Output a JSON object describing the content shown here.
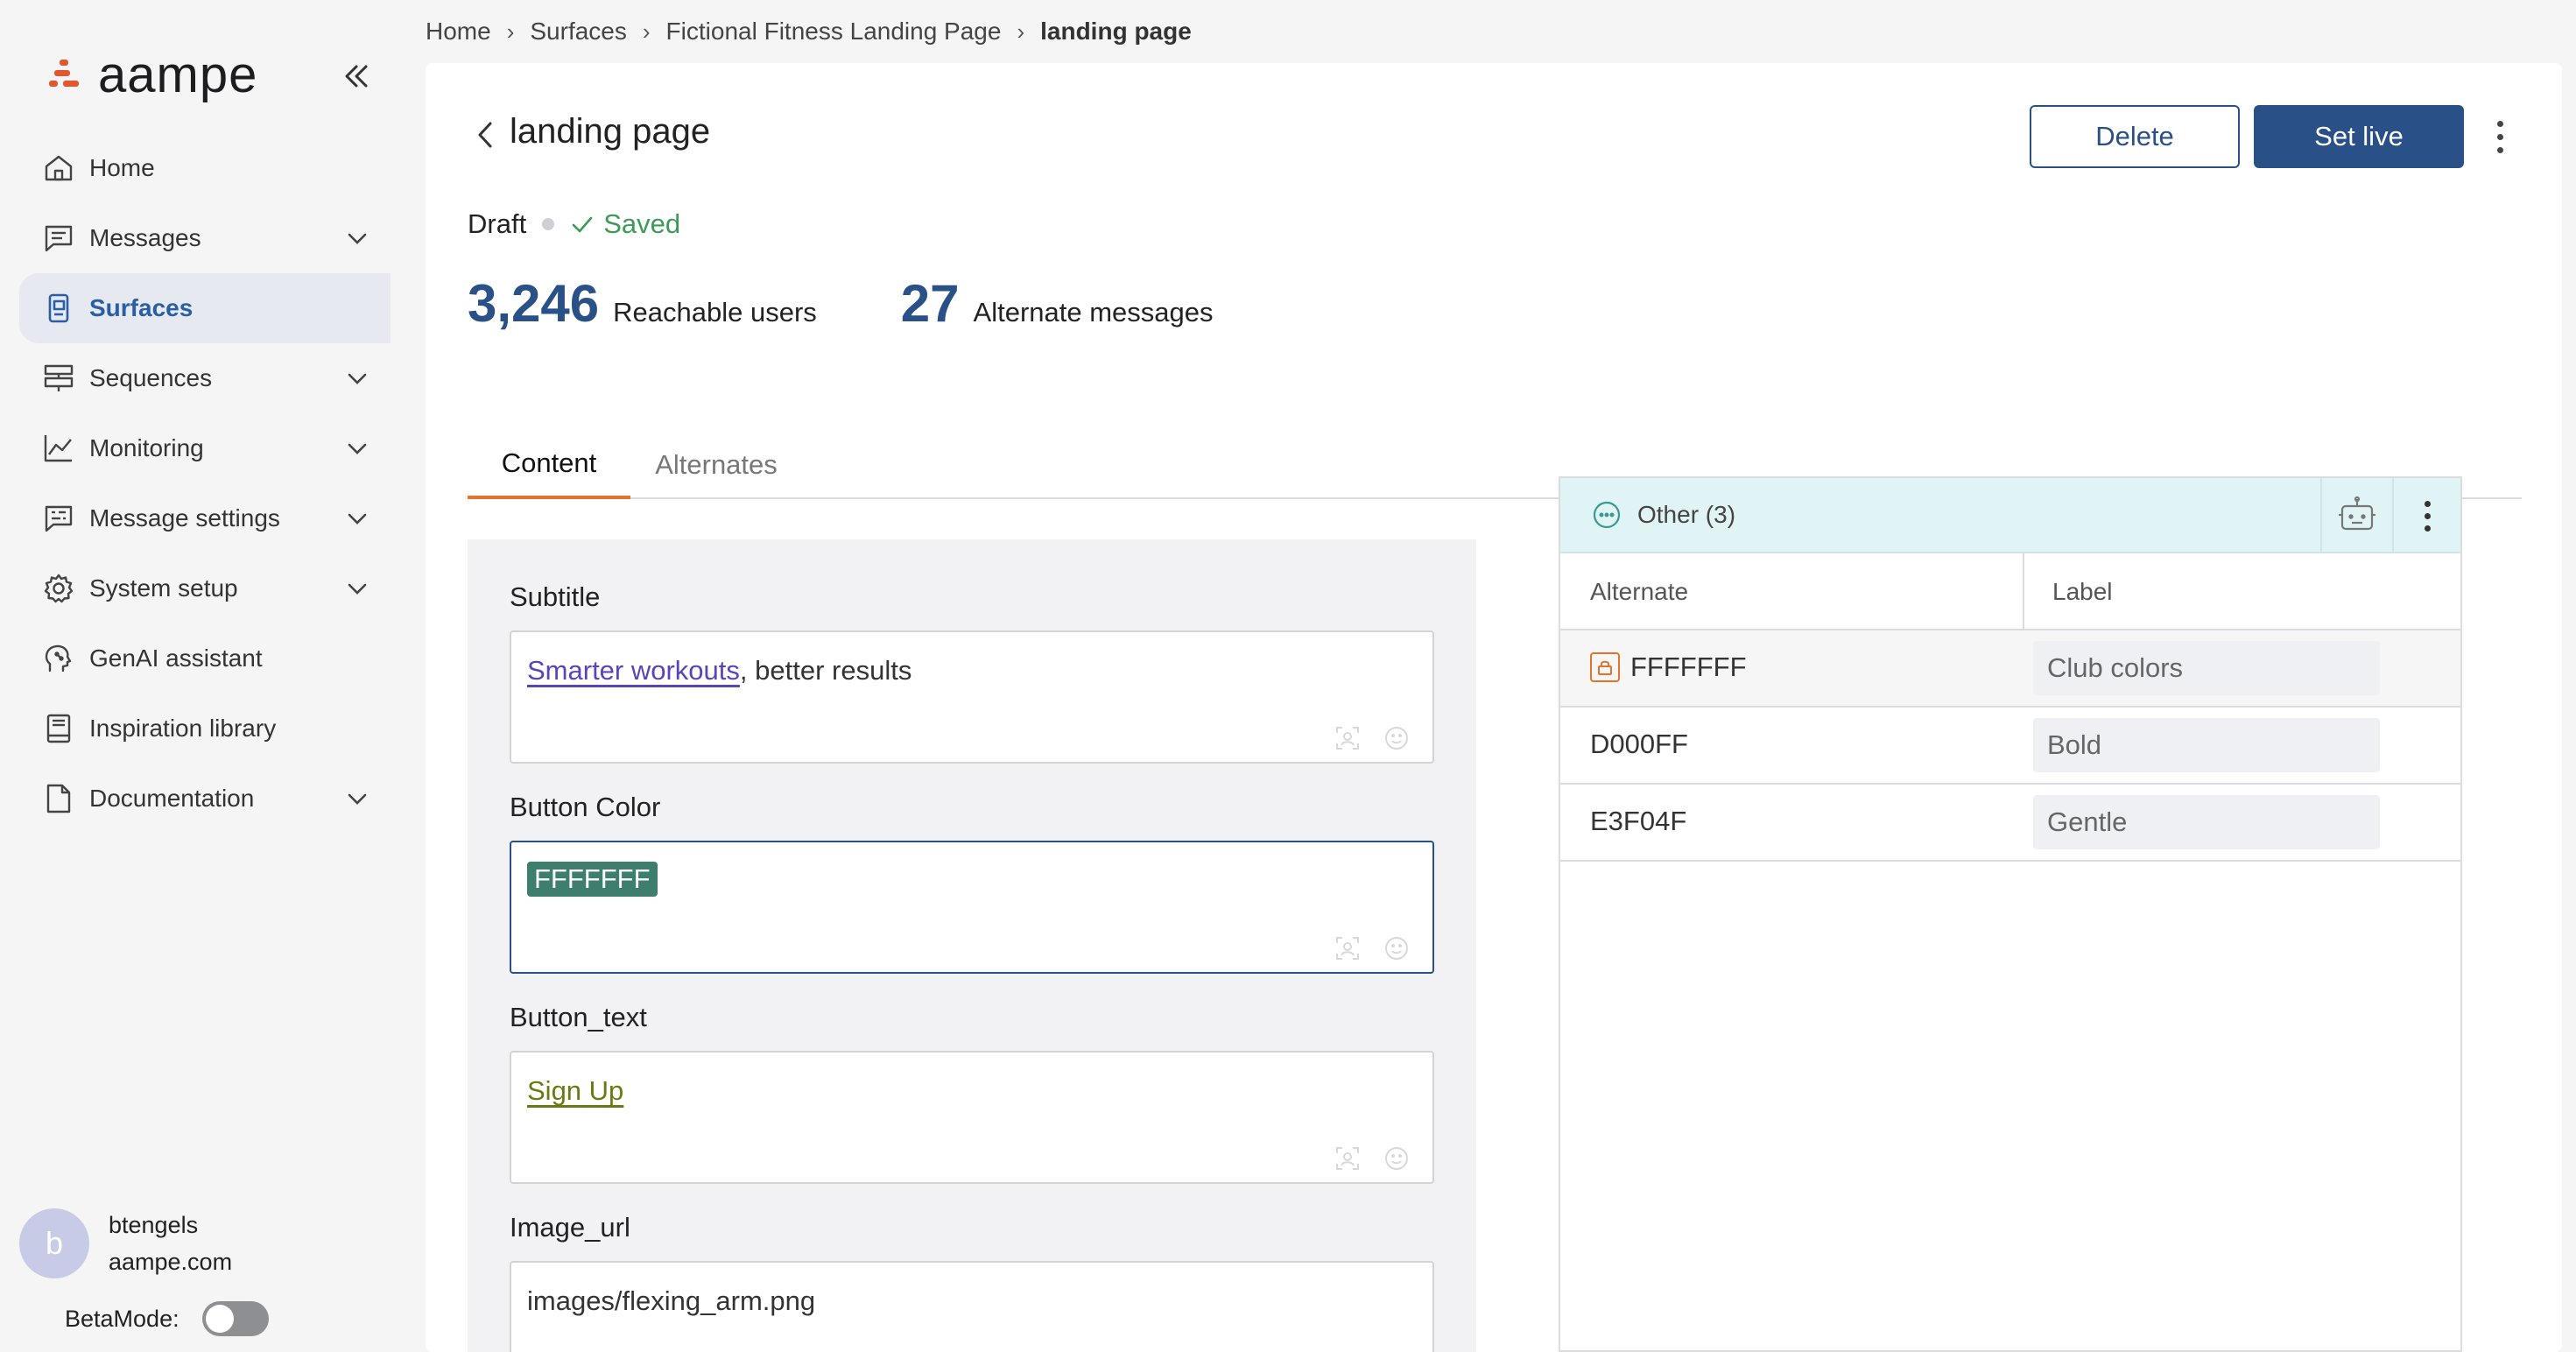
{
  "app": {
    "logo_text": "aampe"
  },
  "sidebar": {
    "items": [
      {
        "label": "Home",
        "icon": "home-icon",
        "has_chevron": false,
        "active": false
      },
      {
        "label": "Messages",
        "icon": "message-icon",
        "has_chevron": true,
        "active": false
      },
      {
        "label": "Surfaces",
        "icon": "surfaces-icon",
        "has_chevron": false,
        "active": true
      },
      {
        "label": "Sequences",
        "icon": "sequences-icon",
        "has_chevron": true,
        "active": false
      },
      {
        "label": "Monitoring",
        "icon": "chart-icon",
        "has_chevron": true,
        "active": false
      },
      {
        "label": "Message settings",
        "icon": "message-settings-icon",
        "has_chevron": true,
        "active": false
      },
      {
        "label": "System setup",
        "icon": "gear-icon",
        "has_chevron": true,
        "active": false
      },
      {
        "label": "GenAI assistant",
        "icon": "genai-icon",
        "has_chevron": false,
        "active": false
      },
      {
        "label": "Inspiration library",
        "icon": "book-icon",
        "has_chevron": false,
        "active": false
      },
      {
        "label": "Documentation",
        "icon": "document-icon",
        "has_chevron": true,
        "active": false
      }
    ],
    "user": {
      "initial": "b",
      "name": "btengels",
      "domain": "aampe.com"
    },
    "beta_mode": {
      "label": "BetaMode:",
      "enabled": false
    }
  },
  "breadcrumb": [
    "Home",
    "Surfaces",
    "Fictional Fitness Landing Page",
    "landing page"
  ],
  "header": {
    "title": "landing page",
    "delete_label": "Delete",
    "set_live_label": "Set live"
  },
  "status": {
    "state": "Draft",
    "saved": "Saved"
  },
  "stats": {
    "reachable_value": "3,246",
    "reachable_label": "Reachable users",
    "alternates_value": "27",
    "alternates_label": "Alternate messages"
  },
  "tabs": [
    "Content",
    "Alternates"
  ],
  "fields": [
    {
      "label": "Subtitle",
      "link_text": "Smarter workouts",
      "rest_text": ", better results"
    },
    {
      "label": "Button Color",
      "chip_text": "FFFFFFF"
    },
    {
      "label": "Button_text",
      "link_text": "Sign Up"
    },
    {
      "label": "Image_url",
      "text": "images/flexing_arm.png"
    }
  ],
  "alternates_panel": {
    "group_label": "Other (3)",
    "col_alternate": "Alternate",
    "col_label": "Label",
    "rows": [
      {
        "value": "FFFFFFF",
        "label": "Club colors",
        "locked": true
      },
      {
        "value": "D000FF",
        "label": "Bold",
        "locked": false
      },
      {
        "value": "E3F04F",
        "label": "Gentle",
        "locked": false
      }
    ]
  },
  "colors": {
    "accent": "#2a5088",
    "tab_underline": "#e4732e",
    "saved_green": "#3d9a58",
    "chip_bg": "#3d7e6e",
    "logo_orange": "#e4572e"
  }
}
